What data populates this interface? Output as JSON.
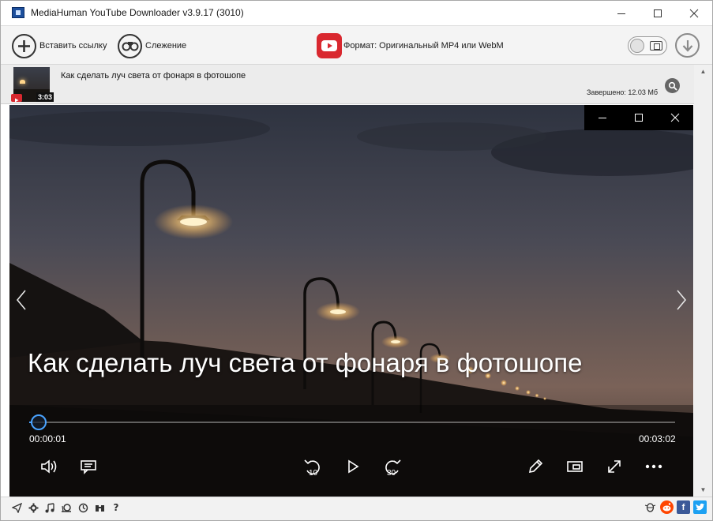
{
  "app": {
    "title": "MediaHuman YouTube Downloader v3.9.17 (3010)"
  },
  "window_controls": {
    "minimize": "minimize",
    "maximize": "maximize",
    "close": "close"
  },
  "toolbar": {
    "paste_link_label": "Вставить ссылку",
    "tracking_label": "Слежение",
    "format_label": "Формат: Оригинальный MP4 или WebM",
    "accent_color": "#d9282f"
  },
  "list": {
    "items": [
      {
        "title": "Как сделать луч света от фонаря в фотошопе",
        "duration": "3:03",
        "status": "Завершено: 12.03 Мб",
        "source": "youtube"
      }
    ]
  },
  "player": {
    "title": "Как сделать луч света от фонаря в фотошопе",
    "current_time": "00:00:01",
    "total_time": "00:03:02",
    "progress": 0.005,
    "skip_back_seconds": "10",
    "skip_forward_seconds": "30",
    "seek_color": "#4aa3ff"
  },
  "statusbar": {
    "icons": [
      "send-icon",
      "gear-icon",
      "music-icon",
      "snail-icon",
      "clock-icon",
      "binoculars-icon",
      "help-icon"
    ],
    "help_glyph": "?",
    "social": [
      "bug-icon",
      "reddit-icon",
      "facebook-icon",
      "twitter-icon"
    ],
    "facebook_glyph": "f"
  }
}
